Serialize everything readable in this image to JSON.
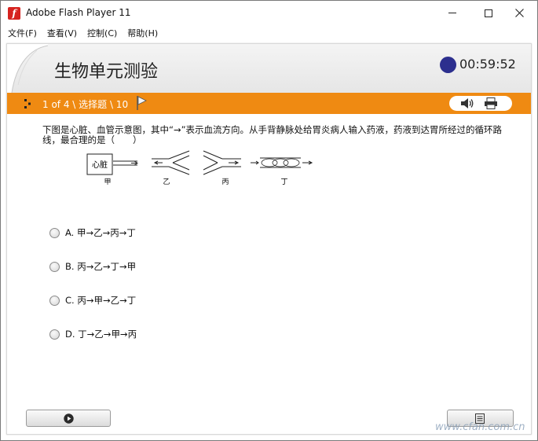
{
  "window": {
    "title": "Adobe Flash Player 11",
    "app_icon_glyph": "f"
  },
  "menu": {
    "items": [
      "文件(F)",
      "查看(V)",
      "控制(C)",
      "帮助(H)"
    ]
  },
  "quiz": {
    "title": "生物单元测验",
    "timer": "00:59:52",
    "timer_color": "#2c2f8e",
    "nav_info": "1 of 4 \\ 选择题 \\ 10",
    "accent_color": "#ef8a12"
  },
  "question": {
    "text": "下图是心脏、血管示意图，其中“→”表示血流方向。从手背静脉处给胃炎病人输入药液，药液到达胃所经过的循环路线，最合理的是（　　）",
    "figure": {
      "heart_label": "心脏",
      "labels": [
        "甲",
        "乙",
        "丙",
        "丁"
      ]
    }
  },
  "options": [
    {
      "label": "A. 甲→乙→丙→丁"
    },
    {
      "label": "B. 丙→乙→丁→甲"
    },
    {
      "label": "C. 丙→甲→乙→丁"
    },
    {
      "label": "D. 丁→乙→甲→丙"
    }
  ],
  "watermark": "www.cfan.com.cn"
}
